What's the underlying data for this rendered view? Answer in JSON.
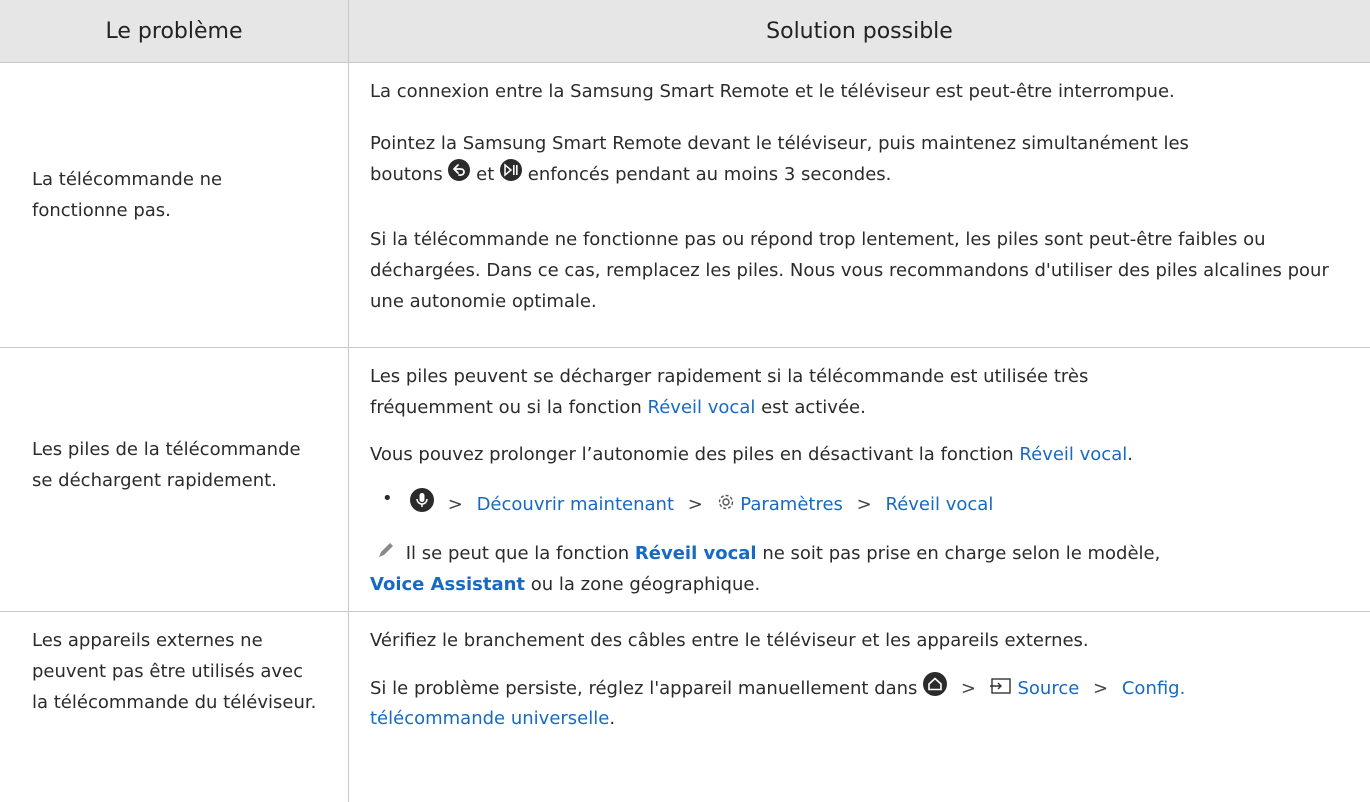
{
  "header": {
    "col1": "Le problème",
    "col2": "Solution possible"
  },
  "row1": {
    "problem": "La télécommande ne fonctionne pas.",
    "p1": "La connexion entre la Samsung Smart Remote et le téléviseur est peut-être interrompue.",
    "p2a": "Pointez la Samsung Smart Remote devant le téléviseur, puis maintenez simultanément les",
    "p2b_start": "boutons",
    "p2b_mid": "et",
    "p2b_end": "enfoncés pendant au moins 3 secondes.",
    "p3": "Si la télécommande ne fonctionne pas ou répond trop lentement, les piles sont peut-être faibles ou déchargées. Dans ce cas, remplacez les piles. Nous vous recommandons d'utiliser des piles alcalines pour une autonomie optimale."
  },
  "row2": {
    "problem": "Les piles de la télécommande se déchargent rapidement.",
    "p1a": "Les piles peuvent se décharger rapidement si la télécommande est utilisée très",
    "p1b_start": "fréquemment ou si la fonction",
    "p1b_link": "Réveil vocal",
    "p1b_end": "est activée.",
    "p2_start": "Vous pouvez prolonger l’autonomie des piles en désactivant la fonction",
    "p2_link": "Réveil vocal",
    "p2_end": ".",
    "path": [
      "Découvrir maintenant",
      "Paramètres",
      "Réveil vocal"
    ],
    "note_start": "Il se peut que la fonction",
    "note_link1": "Réveil vocal",
    "note_mid": "ne soit pas prise en charge selon le modèle,",
    "note_link2": "Voice Assistant",
    "note_end": "ou la zone géographique."
  },
  "row3": {
    "problem": "Les appareils externes ne peuvent pas être utilisés avec la télécommande du téléviseur.",
    "p1": "Vérifiez le branchement des câbles entre le téléviseur et les appareils externes.",
    "p2_start": "Si le problème persiste, réglez l'appareil manuellement dans",
    "p2_source": "Source",
    "p2_link_a": "Config.",
    "p2_link_b": "télécommande universelle",
    "p2_end": "."
  },
  "colors": {
    "header_bg": "#e6e6e6",
    "link": "#1769c2",
    "border": "#c8c8c8"
  },
  "icons": [
    "return-icon",
    "play-pause-icon",
    "microphone-icon",
    "gear-icon",
    "pencil-note-icon",
    "home-icon",
    "source-icon",
    "chevron-right-icon"
  ]
}
